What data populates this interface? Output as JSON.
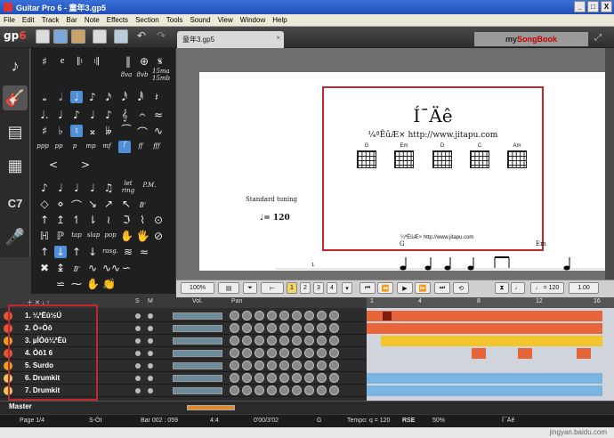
{
  "window": {
    "title": "Guitar Pro 6 - 童年3.gp5",
    "buttons": [
      "_",
      "□",
      "X"
    ]
  },
  "menu": [
    "File",
    "Edit",
    "Track",
    "Bar",
    "Note",
    "Effects",
    "Section",
    "Tools",
    "Sound",
    "View",
    "Window",
    "Help"
  ],
  "toolbar": {
    "logo_a": "gp",
    "logo_b": "6",
    "doc_tab": "童年3.gp5",
    "songbook": "mySongBook",
    "songbook_prefix": "my",
    "songbook_brand": "SongBook"
  },
  "palette": {
    "dynamics": [
      "ppp",
      "pp",
      "p",
      "mp",
      "mf",
      "f",
      "ff",
      "fff"
    ],
    "techniques": [
      "let ring",
      "P.M.",
      "tap",
      "slap",
      "pop",
      "rasg."
    ],
    "octave": [
      "8va",
      "8vb",
      "15ma",
      "15mb"
    ]
  },
  "score": {
    "title": "Í¯Äê",
    "subtitle": "¼ªËûÆ× http://www.jitapu.com",
    "chords": [
      "G",
      "Em",
      "D",
      "C",
      "Am"
    ],
    "source": "¼ªËûÆ× http://www.jitapu.com",
    "tuning": "Standard tuning",
    "tempo": "♩= 120",
    "g_label": "G",
    "em_label": "Em",
    "bar_num": "1"
  },
  "transport": {
    "zoom": "100%",
    "voices": [
      "1",
      "2",
      "3",
      "4"
    ],
    "tempo": "♩ = 120",
    "speed": "1.00"
  },
  "tracks_header": {
    "s": "S",
    "m": "M",
    "vol": "Vol.",
    "pan": "Pan"
  },
  "tracks": [
    {
      "name": "1. ¼ªËû½Ú",
      "color": "#e0583a"
    },
    {
      "name": "2. Ö÷Òô",
      "color": "#e0583a"
    },
    {
      "name": "3. µÍÒô¼ªËû",
      "color": "#e8a020"
    },
    {
      "name": "4. Òô1 6",
      "color": "#e0583a"
    },
    {
      "name": "5. Surdo",
      "color": "#e8a020"
    },
    {
      "name": "6. Drumkit",
      "color": "#e8c860"
    },
    {
      "name": "7. Drumkit",
      "color": "#e8c860"
    }
  ],
  "timeline_numbers": [
    "1",
    "4",
    "8",
    "12",
    "16"
  ],
  "master": {
    "label": "Master"
  },
  "status": {
    "page": "Page 1/4",
    "track": "S-Òt",
    "bar": "Bar 002 : 059",
    "sig": "4:4",
    "time": "0'00/3'02",
    "key": "G",
    "tempo": "Tempo: q = 120",
    "rse": "RSE",
    "cpu": "50%",
    "song": "Í¯Äê"
  },
  "watermark": "jingyan.baidu.com"
}
